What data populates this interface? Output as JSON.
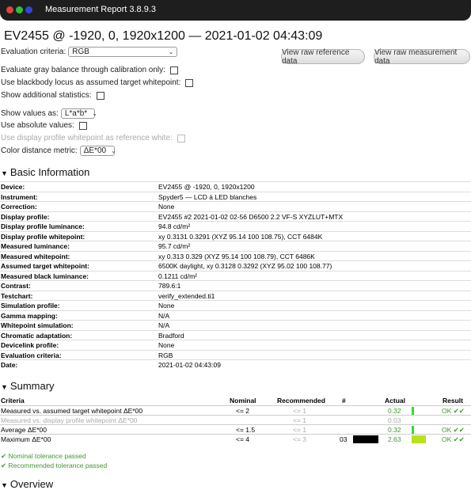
{
  "window": {
    "title": "Measurement Report 3.8.9.3"
  },
  "report": {
    "title": "EV2455 @ -1920, 0, 1920x1200 — 2021-01-02 04:43:09"
  },
  "controls": {
    "evaluation_criteria_label": "Evaluation criteria:",
    "evaluation_criteria_value": "RGB",
    "view_reference_label": "View raw reference data",
    "view_measurement_label": "View raw measurement data",
    "gray_balance_label": "Evaluate gray balance through calibration only:",
    "blackbody_label": "Use blackbody locus as assumed target whitepoint:",
    "additional_stats_label": "Show additional statistics:",
    "show_values_label": "Show values as:",
    "show_values_value": "L*a*b*",
    "absolute_values_label": "Use absolute values:",
    "display_whitepoint_label": "Use display profile whitepoint as reference white:",
    "color_distance_label": "Color distance metric:",
    "color_distance_value": "ΔE*00"
  },
  "basic_info": {
    "heading": "Basic Information",
    "rows": [
      {
        "k": "Device:",
        "v": "EV2455 @ -1920, 0, 1920x1200"
      },
      {
        "k": "Instrument:",
        "v": "Spyder5 — LCD à LED blanches"
      },
      {
        "k": "Correction:",
        "v": "None"
      },
      {
        "k": "Display profile:",
        "v": "EV2455 #2 2021-01-02 02-56 D6500 2.2 VF-S XYZLUT+MTX"
      },
      {
        "k": "Display profile luminance:",
        "v": "94.8 cd/m²"
      },
      {
        "k": "Display profile whitepoint:",
        "v": "xy 0.3131 0.3291 (XYZ 95.14 100 108.75), CCT 6484K"
      },
      {
        "k": "Measured luminance:",
        "v": "95.7 cd/m²"
      },
      {
        "k": "Measured whitepoint:",
        "v": "xy 0.313 0.329 (XYZ 95.14 100 108.79), CCT 6486K"
      },
      {
        "k": "Assumed target whitepoint:",
        "v": "6500K daylight, xy 0.3128 0.3292 (XYZ 95.02 100 108.77)"
      },
      {
        "k": "Measured black luminance:",
        "v": "0.1211 cd/m²"
      },
      {
        "k": "Contrast:",
        "v": "789.6:1"
      },
      {
        "k": "Testchart:",
        "v": "verify_extended.ti1"
      },
      {
        "k": "Simulation profile:",
        "v": "None"
      },
      {
        "k": "Gamma mapping:",
        "v": "N/A"
      },
      {
        "k": "Whitepoint simulation:",
        "v": "N/A"
      },
      {
        "k": "Chromatic adaptation:",
        "v": "Bradford"
      },
      {
        "k": "Devicelink profile:",
        "v": "None"
      },
      {
        "k": "Evaluation criteria:",
        "v": "RGB"
      },
      {
        "k": "Date:",
        "v": "2021-01-02 04:43:09"
      }
    ]
  },
  "summary": {
    "heading": "Summary",
    "headers": {
      "criteria": "Criteria",
      "nominal": "Nominal",
      "recommended": "Recommended",
      "num": "#",
      "actual": "Actual",
      "result": "Result"
    },
    "rows": [
      {
        "criteria": "Measured vs. assumed target whitepoint ΔE*00",
        "nominal": "<= 2",
        "recommended": "<= 1",
        "num": "",
        "actual": "0.32",
        "result": "OK ✔✔",
        "bar_fraction": 0.16,
        "bar_color": "#33dd33",
        "muted": false
      },
      {
        "criteria": "Measured vs. display profile whitepoint ΔE*00",
        "nominal": "",
        "recommended": "<= 1",
        "num": "",
        "actual": "0.03",
        "result": "",
        "bar_fraction": 0,
        "bar_color": "#33dd33",
        "muted": true
      },
      {
        "criteria": "Average ΔE*00",
        "nominal": "<= 1.5",
        "recommended": "<= 1",
        "num": "",
        "actual": "0.32",
        "result": "OK ✔✔",
        "bar_fraction": 0.16,
        "bar_color": "#33dd33",
        "muted": false
      },
      {
        "criteria": "Maximum ΔE*00",
        "nominal": "<= 4",
        "recommended": "<= 3",
        "num": "03",
        "actual": "2.63",
        "result": "OK ✔✔",
        "bar_fraction": 0.9,
        "bar_color": "#b8e21a",
        "muted": false
      }
    ],
    "nominal_passed": "✔ Nominal tolerance passed",
    "recommended_passed": "✔ Recommended tolerance passed"
  },
  "overview": {
    "heading": "Overview"
  }
}
